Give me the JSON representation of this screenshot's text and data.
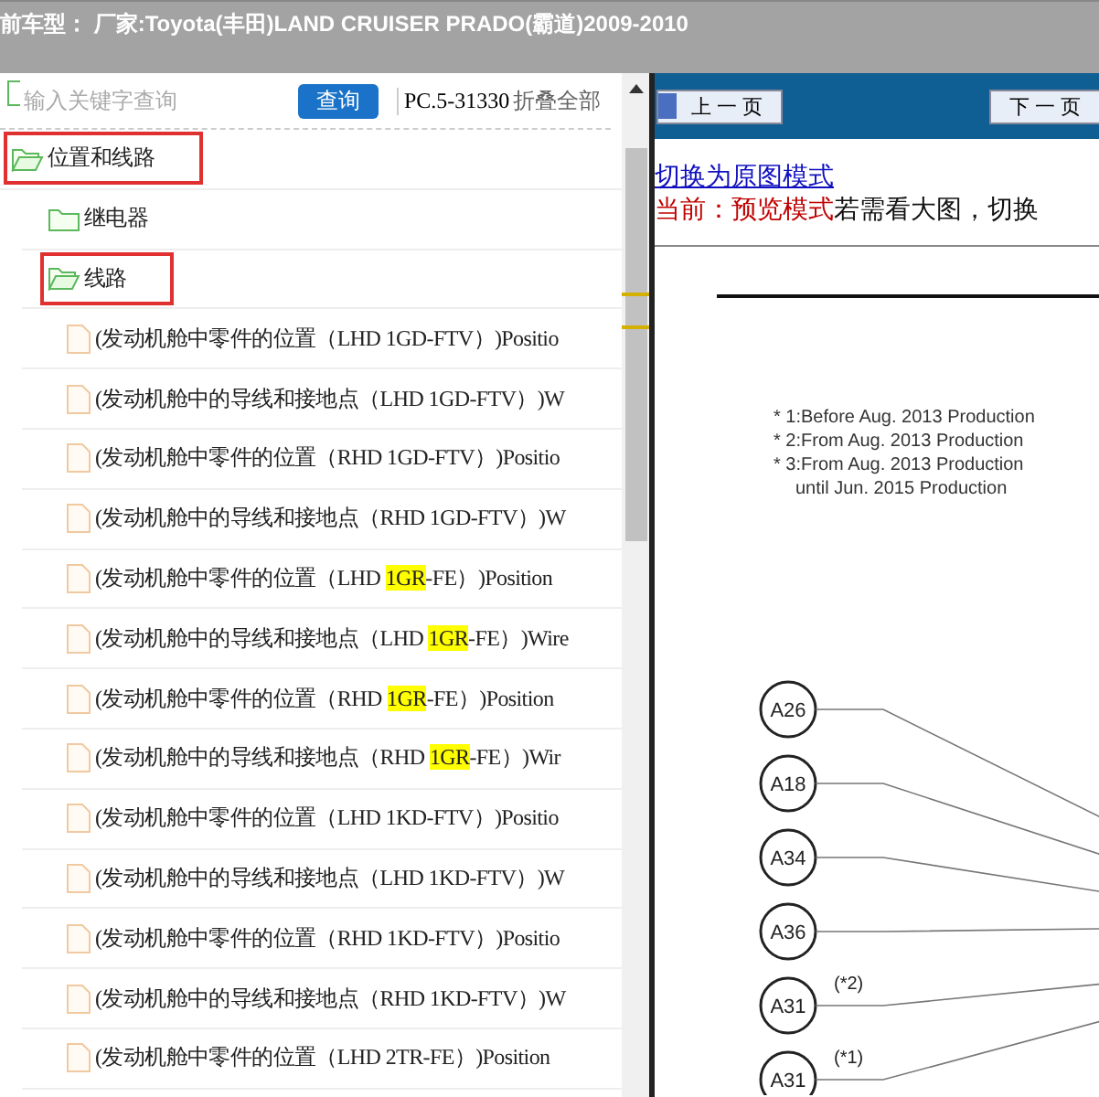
{
  "header": {
    "title": "前车型：  厂家:Toyota(丰田)LAND CRUISER PRADO(霸道)2009-2010"
  },
  "search": {
    "placeholder": "输入关键字查询",
    "button": "查询",
    "code": "PC.5-31330",
    "collapse_all": "折叠全部"
  },
  "tree": [
    {
      "kind": "folder",
      "label": [
        {
          "text": "位置和线路",
          "highlight": false
        }
      ],
      "expanded": true,
      "marked": true,
      "children": [
        {
          "kind": "folder",
          "label": [
            {
              "text": "继电器",
              "highlight": false
            }
          ],
          "expanded": false,
          "marked": false
        },
        {
          "kind": "folder",
          "label": [
            {
              "text": "线路",
              "highlight": false
            }
          ],
          "expanded": true,
          "marked": true,
          "children": [
            {
              "kind": "file",
              "label": [
                {
                  "text": "(发动机舱中零件的位置（LHD 1GD-FTV）)Positio",
                  "highlight": false
                }
              ]
            },
            {
              "kind": "file",
              "label": [
                {
                  "text": "(发动机舱中的导线和接地点（LHD 1GD-FTV）)W",
                  "highlight": false
                }
              ]
            },
            {
              "kind": "file",
              "label": [
                {
                  "text": "(发动机舱中零件的位置（RHD 1GD-FTV）)Positio",
                  "highlight": false
                }
              ]
            },
            {
              "kind": "file",
              "label": [
                {
                  "text": "(发动机舱中的导线和接地点（RHD 1GD-FTV）)W",
                  "highlight": false
                }
              ]
            },
            {
              "kind": "file",
              "label": [
                {
                  "text": "(发动机舱中零件的位置（LHD ",
                  "highlight": false
                },
                {
                  "text": "1GR",
                  "highlight": true
                },
                {
                  "text": "-FE）)Position",
                  "highlight": false
                }
              ]
            },
            {
              "kind": "file",
              "label": [
                {
                  "text": "(发动机舱中的导线和接地点（LHD ",
                  "highlight": false
                },
                {
                  "text": "1GR",
                  "highlight": true
                },
                {
                  "text": "-FE）)Wire",
                  "highlight": false
                }
              ]
            },
            {
              "kind": "file",
              "label": [
                {
                  "text": "(发动机舱中零件的位置（RHD ",
                  "highlight": false
                },
                {
                  "text": "1GR",
                  "highlight": true
                },
                {
                  "text": "-FE）)Position",
                  "highlight": false
                }
              ]
            },
            {
              "kind": "file",
              "label": [
                {
                  "text": "(发动机舱中的导线和接地点（RHD ",
                  "highlight": false
                },
                {
                  "text": "1GR",
                  "highlight": true
                },
                {
                  "text": "-FE）)Wir",
                  "highlight": false
                }
              ]
            },
            {
              "kind": "file",
              "label": [
                {
                  "text": "(发动机舱中零件的位置（LHD 1KD-FTV）)Positio",
                  "highlight": false
                }
              ]
            },
            {
              "kind": "file",
              "label": [
                {
                  "text": "(发动机舱中的导线和接地点（LHD 1KD-FTV）)W",
                  "highlight": false
                }
              ]
            },
            {
              "kind": "file",
              "label": [
                {
                  "text": "(发动机舱中零件的位置（RHD 1KD-FTV）)Positio",
                  "highlight": false
                }
              ]
            },
            {
              "kind": "file",
              "label": [
                {
                  "text": "(发动机舱中的导线和接地点（RHD 1KD-FTV）)W",
                  "highlight": false
                }
              ]
            },
            {
              "kind": "file",
              "label": [
                {
                  "text": "(发动机舱中零件的位置（LHD 2TR-FE）)Position",
                  "highlight": false
                }
              ]
            }
          ]
        }
      ]
    }
  ],
  "viewer": {
    "prev_button": "上 一 页",
    "next_button": "下 一 页",
    "switch_link": "切换为原图模式",
    "mode_label": "当前：预览模式",
    "mode_hint": "若需看大图，切换",
    "document": {
      "notes": [
        "* 1:Before Aug. 2013 Production",
        "* 2:From Aug. 2013 Production",
        "* 3:From Aug. 2013 Production",
        "until Jun. 2015 Production"
      ],
      "connectors": [
        {
          "label": "A26"
        },
        {
          "label": "A18"
        },
        {
          "label": "A34"
        },
        {
          "label": "A36"
        },
        {
          "label": "A31",
          "note": "(*2)"
        },
        {
          "label": "A31",
          "note": "(*1)"
        }
      ]
    }
  }
}
